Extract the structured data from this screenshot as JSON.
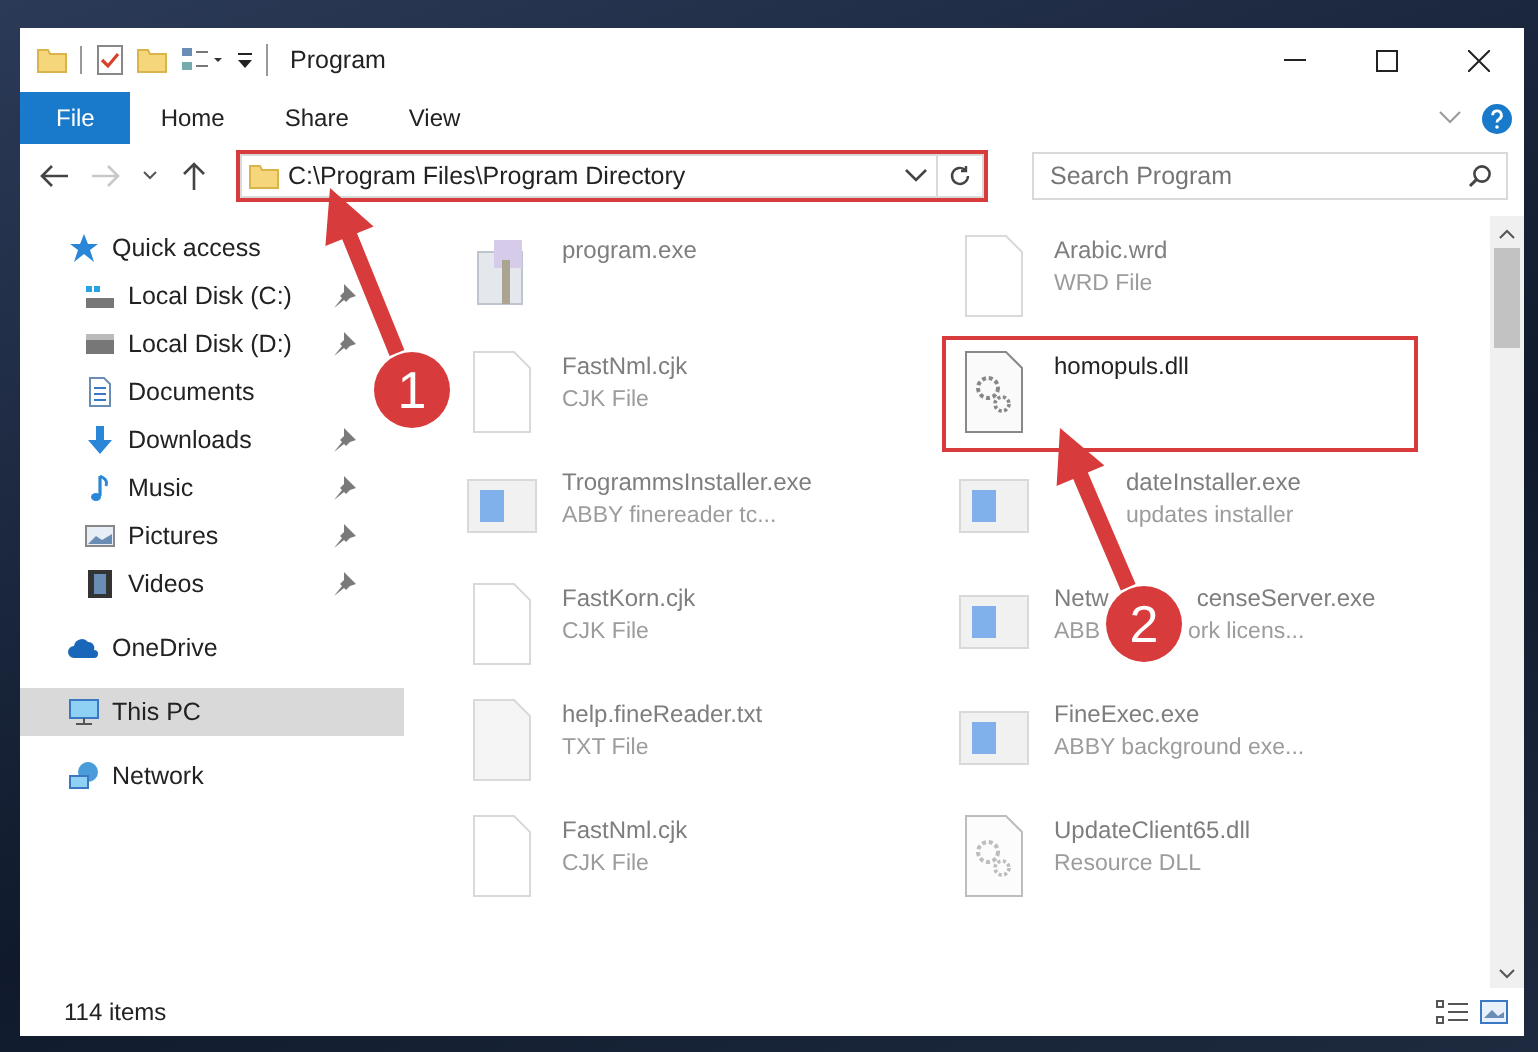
{
  "window": {
    "title": "Program"
  },
  "ribbon_tabs": [
    {
      "label": "File",
      "selected": true
    },
    {
      "label": "Home",
      "selected": false
    },
    {
      "label": "Share",
      "selected": false
    },
    {
      "label": "View",
      "selected": false
    }
  ],
  "navigation": {
    "forward_disabled": true
  },
  "address_bar": {
    "path": "C:\\Program Files\\Program Directory",
    "highlighted": true
  },
  "search": {
    "placeholder": "Search Program"
  },
  "sidebar": {
    "items": [
      {
        "label": "Quick access",
        "kind": "star",
        "selected": false,
        "children": [
          {
            "label": "Local Disk (C:)",
            "kind": "drive-c",
            "selected": false,
            "pinned": true
          },
          {
            "label": "Local Disk (D:)",
            "kind": "drive",
            "selected": false,
            "pinned": true
          },
          {
            "label": "Documents",
            "kind": "documents",
            "selected": false
          },
          {
            "label": "Downloads",
            "kind": "downloads",
            "selected": false,
            "pinned": true
          },
          {
            "label": "Music",
            "kind": "music",
            "selected": false,
            "pinned": true
          },
          {
            "label": "Pictures",
            "kind": "pictures",
            "selected": false,
            "pinned": true
          },
          {
            "label": "Videos",
            "kind": "videos",
            "selected": false,
            "pinned": true
          }
        ]
      },
      {
        "label": "OneDrive",
        "kind": "cloud",
        "selected": false
      },
      {
        "label": "This PC",
        "kind": "computer",
        "selected": true
      },
      {
        "label": "Network",
        "kind": "network",
        "selected": false
      }
    ]
  },
  "files": [
    {
      "name": "program.exe",
      "kind": "setup",
      "faded": true,
      "highlighted": false
    },
    {
      "name": "Arabic.wrd",
      "type": "WRD File",
      "kind": "document",
      "faded": true,
      "highlighted": false
    },
    {
      "name": "FastNml.cjk",
      "type": "CJK File",
      "kind": "document",
      "faded": true,
      "highlighted": false
    },
    {
      "name": "homopuls.dll",
      "kind": "gears",
      "faded": false,
      "highlighted": true
    },
    {
      "name": "TrogrammsInstaller.exe",
      "type": "ABBY finereader tc...",
      "kind": "app",
      "faded": true,
      "highlighted": false
    },
    {
      "name_parts": [
        "dateInstaller.exe"
      ],
      "type_parts": [
        "updates installer"
      ],
      "kind": "app",
      "faded": true,
      "highlighted": false
    },
    {
      "name": "FastKorn.cjk",
      "type": "CJK File",
      "kind": "document",
      "faded": true,
      "highlighted": false
    },
    {
      "name_parts": [
        "Netw",
        "censeServer.exe"
      ],
      "type_parts": [
        "ABB",
        "ork licens..."
      ],
      "kind": "app",
      "faded": true,
      "highlighted": false
    },
    {
      "name": "help.fineReader.txt",
      "type": "TXT File",
      "kind": "text",
      "faded": true,
      "highlighted": false
    },
    {
      "name": "FineExec.exe",
      "type": "ABBY background exe...",
      "kind": "app",
      "faded": true,
      "highlighted": false
    },
    {
      "name": "FastNml.cjk",
      "type": "CJK File",
      "kind": "document",
      "faded": true,
      "highlighted": false
    },
    {
      "name": "UpdateClient65.dll",
      "type": "Resource DLL",
      "kind": "gears",
      "faded": true,
      "highlighted": false
    }
  ],
  "status_bar": {
    "item_count": "114 items"
  },
  "annotations": [
    {
      "number": "1"
    },
    {
      "number": "2"
    }
  ]
}
